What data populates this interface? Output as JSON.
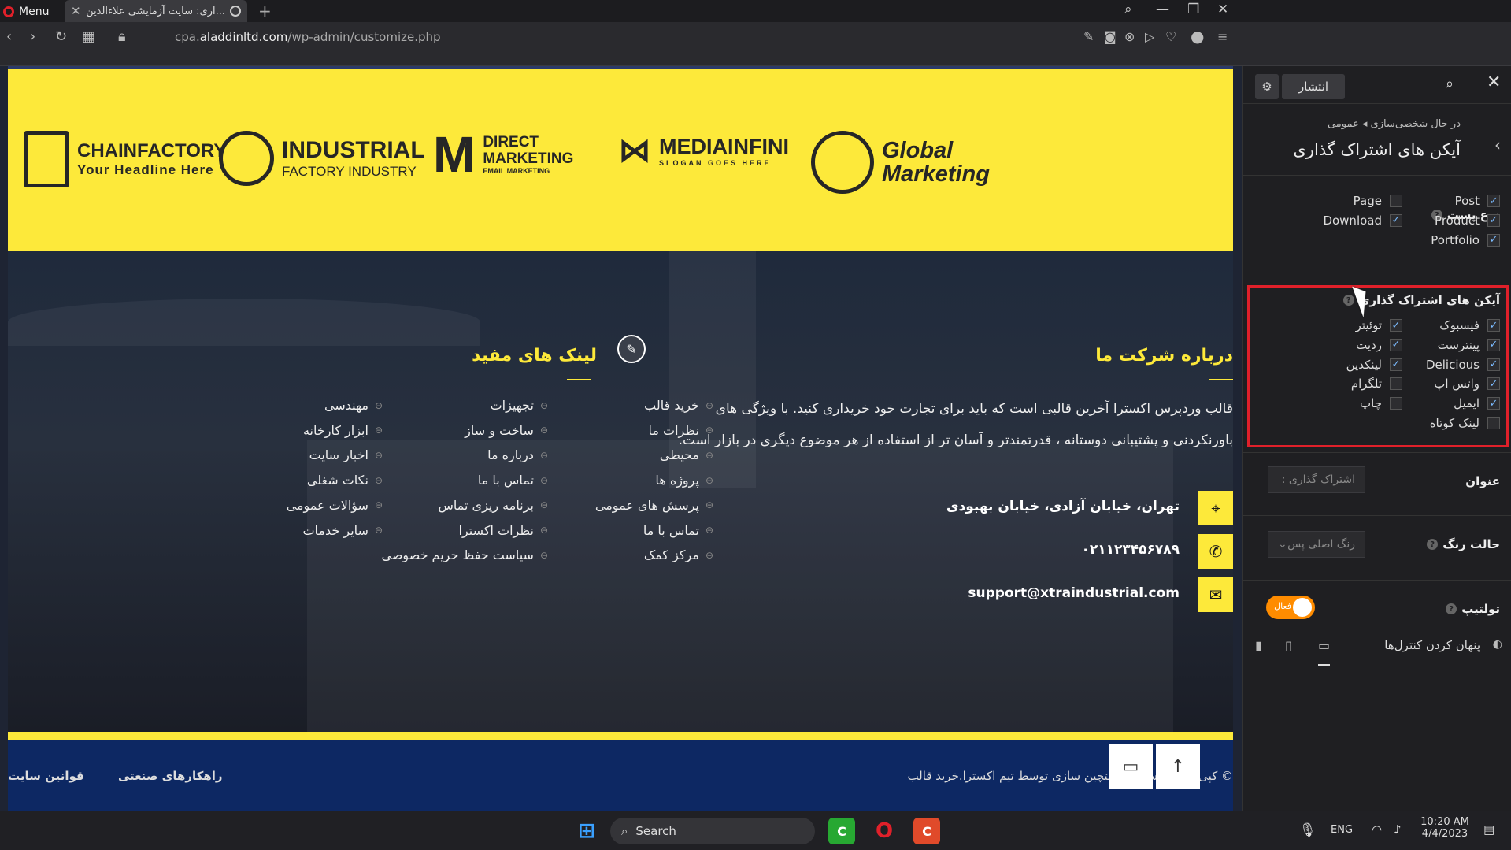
{
  "browser": {
    "menu_label": "Menu",
    "tab_title": "...اری: سایت آزمایشی علاءالدین",
    "url_prefix": "cpa.",
    "url_domain": "aladdinltd.com",
    "url_path": "/wp-admin/customize.php"
  },
  "preview": {
    "logos": [
      {
        "title": "CHAINFACTORY",
        "sub": "Your Headline Here"
      },
      {
        "title": "INDUSTRIAL",
        "sub": "FACTORY INDUSTRY"
      },
      {
        "title": "DIRECT MARKETING",
        "sub": "EMAIL MARKETING"
      },
      {
        "title": "MEDIAINFINI",
        "sub": "SLOGAN GOES HERE"
      },
      {
        "title": "Global Marketing",
        "sub": ""
      }
    ],
    "about_heading": "درباره شرکت ما",
    "about_text_1": "قالب وردپرس اکسترا آخرین قالبی است که باید برای تجارت خود خریداری کنید. با ویژگی های",
    "about_text_2": "باورنکردنی و پشتیبانی دوستانه ، قدرتمندتر و آسان تر از استفاده از هر موضوع دیگری در بازار است.",
    "address": "تهران، خیابان آزادی، خیابان بهبودی",
    "phone": "۰۲۱۱۲۳۴۵۶۷۸۹",
    "email": "support@xtraindustrial.com",
    "links_heading": "لینک های مفید",
    "links_col1": [
      "خرید قالب",
      "نظرات ما",
      "محیطی",
      "پروژه ها",
      "پرسش های عمومی",
      "تماس با ما",
      "مرکز کمک"
    ],
    "links_col2": [
      "تجهیزات",
      "ساخت و ساز",
      "درباره ما",
      "تماس با ما",
      "برنامه ریزی تماس",
      "نظرات اکسترا",
      "سیاست حفظ حریم خصوصی"
    ],
    "links_col3": [
      "مهندسی",
      "ابزار کارخانه",
      "اخبار سایت",
      "نکات شغلی",
      "سؤالات عمومی",
      "سایر خدمات"
    ],
    "footer_copyright": "© کپی رایت اکسترا. راستچین سازی توسط تیم اکسترا.خرید قالب",
    "footer_link_1": "راهکارهای صنعتی",
    "footer_link_2": "قوانین سایت"
  },
  "panel": {
    "publish_label": "انتشار",
    "breadcrumb": "در حال شخصی‌سازی ◂ عمومی",
    "title": "آیکن های اشتراک گذاری",
    "post_type_heading": "نوع پست",
    "post_types": [
      {
        "label": "Post",
        "checked": true
      },
      {
        "label": "Page",
        "checked": false
      },
      {
        "label": "Product",
        "checked": true
      },
      {
        "label": "Download",
        "checked": true
      },
      {
        "label": "Portfolio",
        "checked": true
      }
    ],
    "share_heading": "آیکن های اشتراک گذاری",
    "share_icons": [
      {
        "label": "فیسبوک",
        "checked": true
      },
      {
        "label": "توئیتر",
        "checked": true
      },
      {
        "label": "پینترست",
        "checked": true
      },
      {
        "label": "ردیت",
        "checked": true
      },
      {
        "label": "Delicious",
        "checked": true
      },
      {
        "label": "لینکدین",
        "checked": true
      },
      {
        "label": "واتس اپ",
        "checked": true
      },
      {
        "label": "تلگرام",
        "checked": false
      },
      {
        "label": "ایمیل",
        "checked": true
      },
      {
        "label": "چاپ",
        "checked": false
      },
      {
        "label": "لینک کوتاه",
        "checked": false
      }
    ],
    "title_field_label": "عنوان",
    "title_field_placeholder": "اشتراک گذاری :",
    "color_mode_label": "حالت رنگ",
    "color_mode_value": "رنگ اصلی پس",
    "tooltip_label": "تولتیپ",
    "tooltip_toggle": "فعال",
    "hide_controls_label": "پنهان کردن کنترل‌ها"
  },
  "taskbar": {
    "search_label": "Search",
    "lang": "ENG",
    "time": "10:20 AM",
    "date": "4/4/2023"
  }
}
